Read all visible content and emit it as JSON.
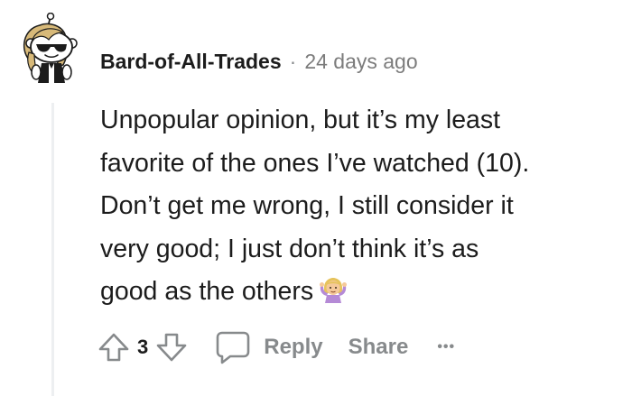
{
  "comment": {
    "author": "Bard-of-All-Trades",
    "separator": "·",
    "timestamp": "24 days ago",
    "body_lines": [
      "Unpopular opinion, but it’s my least",
      "favorite of the ones I’ve watched (10).",
      "Don’t get me wrong, I still consider it",
      "very good; I just don’t think it’s as",
      "good as the others"
    ],
    "emoji": "woman-shrugging-emoji",
    "score": "3"
  },
  "actions": {
    "reply_label": "Reply",
    "share_label": "Share",
    "more_label": "•••"
  },
  "icons": {
    "upvote": "upvote-arrow-icon",
    "downvote": "downvote-arrow-icon",
    "reply": "speech-bubble-icon",
    "more": "ellipsis-icon"
  },
  "colors": {
    "text": "#1c1c1c",
    "muted": "#878a8c",
    "thread_line": "#edeff1"
  }
}
